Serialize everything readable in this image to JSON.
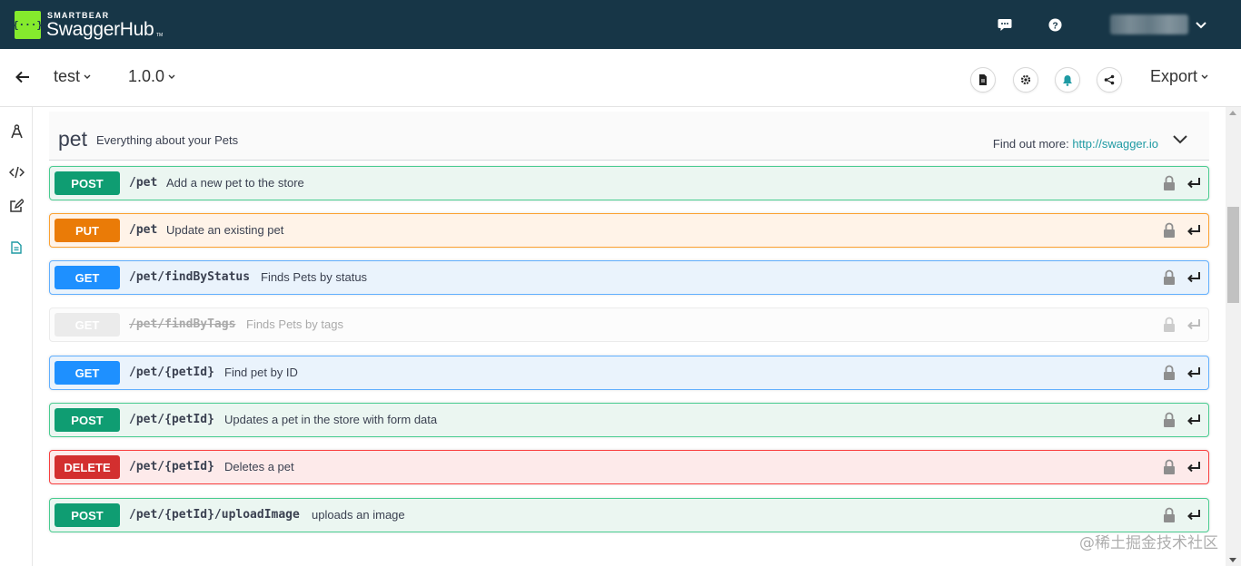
{
  "brand": {
    "company": "SMARTBEAR",
    "product": "SwaggerHub",
    "tm": "TM",
    "logo_glyph": "{···}",
    "accent": "#85ea2d"
  },
  "topbar": {
    "bg": "#173647",
    "icons": [
      "chat-icon",
      "help-icon",
      "chevron-down-icon"
    ]
  },
  "subbar": {
    "api_name": "test",
    "version": "1.0.0",
    "export_label": "Export",
    "actions": [
      "document-icon",
      "settings-icon",
      "notifications-icon",
      "share-icon"
    ]
  },
  "rail": {
    "items": [
      "design-icon",
      "code-icon",
      "edit-icon",
      "docs-icon"
    ]
  },
  "tag": {
    "name": "pet",
    "description": "Everything about your Pets",
    "find_more_label": "Find out more:",
    "find_more_link": "http://swagger.io"
  },
  "operations": [
    {
      "method": "POST",
      "path": "/pet",
      "summary": "Add a new pet to the store",
      "kind": "post"
    },
    {
      "method": "PUT",
      "path": "/pet",
      "summary": "Update an existing pet",
      "kind": "put"
    },
    {
      "method": "GET",
      "path": "/pet/findByStatus",
      "summary": "Finds Pets by status",
      "kind": "get"
    },
    {
      "method": "GET",
      "path": "/pet/findByTags",
      "summary": "Finds Pets by tags",
      "kind": "deprecated"
    },
    {
      "method": "GET",
      "path": "/pet/{petId}",
      "summary": "Find pet by ID",
      "kind": "get"
    },
    {
      "method": "POST",
      "path": "/pet/{petId}",
      "summary": "Updates a pet in the store with form data",
      "kind": "post"
    },
    {
      "method": "DELETE",
      "path": "/pet/{petId}",
      "summary": "Deletes a pet",
      "kind": "delete"
    },
    {
      "method": "POST",
      "path": "/pet/{petId}/uploadImage",
      "summary": "uploads an image",
      "kind": "post"
    }
  ],
  "colors": {
    "post": "#0f9d72",
    "put": "#ea7b07",
    "get": "#1e90ff",
    "delete": "#d32f2f",
    "link": "#1e9aa3"
  },
  "watermark": "@稀土掘金技术社区"
}
